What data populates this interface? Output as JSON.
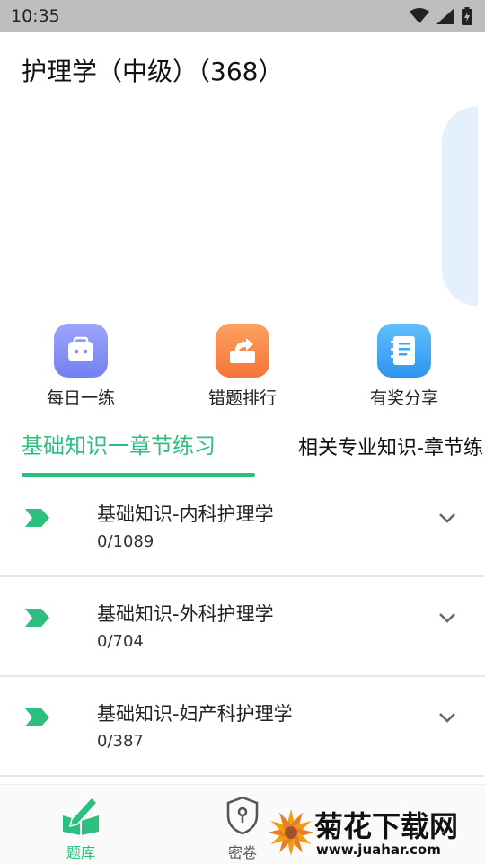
{
  "status_bar": {
    "time": "10:35"
  },
  "header": {
    "title": "护理学（中级）（368）"
  },
  "quick_actions": [
    {
      "label": "每日一练",
      "icon": "briefcase-icon",
      "color": "#7f8cf5"
    },
    {
      "label": "错题排行",
      "icon": "share-box-icon",
      "color": "#f98a43"
    },
    {
      "label": "有奖分享",
      "icon": "notebook-icon",
      "color": "#3aa6f5"
    }
  ],
  "tabs": [
    {
      "label": "基础知识一章节练习",
      "active": true
    },
    {
      "label": "相关专业知识-章节练习",
      "active": false
    }
  ],
  "chapters": [
    {
      "title": "基础知识-内科护理学",
      "count": "0/1089"
    },
    {
      "title": "基础知识-外科护理学",
      "count": "0/704"
    },
    {
      "title": "基础知识-妇产科护理学",
      "count": "0/387"
    }
  ],
  "bottom_nav": [
    {
      "label": "题库",
      "icon": "book-pen-icon",
      "active": true
    },
    {
      "label": "密卷",
      "icon": "shield-keyhole-icon",
      "active": false
    }
  ],
  "watermark": {
    "text": "菊花下载网",
    "url": "www.juahar.com"
  },
  "colors": {
    "accent": "#2dbf7e",
    "status_bar": "#bdbdbd"
  }
}
